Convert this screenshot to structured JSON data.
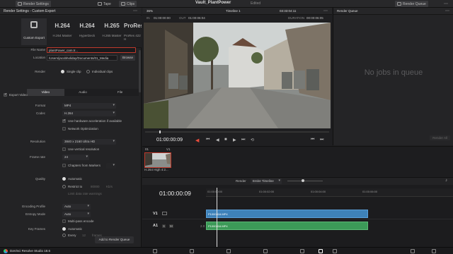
{
  "topbar": {
    "buttons": [
      {
        "label": "Render Settings",
        "icon": "sliders-icon"
      },
      {
        "label": "Tape",
        "icon": "tape-icon"
      },
      {
        "label": "Clips",
        "icon": "clips-icon"
      }
    ],
    "project_title": "Vault_PlantPower",
    "edited_status": "Edited",
    "render_queue_label": "Render Queue"
  },
  "render_settings": {
    "header": "Render Settings - Custom Export",
    "presets": [
      {
        "big": "",
        "label": "Custom Export"
      },
      {
        "big": "H.264",
        "label": "H.264 Master"
      },
      {
        "big": "H.264",
        "label": "HyperDeck"
      },
      {
        "big": "H.265",
        "label": "H.265 Master"
      },
      {
        "big": "ProRes",
        "label": "ProRes 422 H"
      }
    ],
    "file_name_label": "File Name",
    "file_name_value": "plantPower_cam.tr...",
    "location_label": "Location",
    "location_value": "/Users/jacobholiday/Documents/01_Media",
    "browse_label": "Browse",
    "render_label": "Render",
    "single_clip_label": "Single clip",
    "individual_clips_label": "Individual clips",
    "tabs": [
      "Video",
      "Audio",
      "File"
    ],
    "export_video_label": "Export Video",
    "format_label": "Format",
    "format_value": "MP4",
    "codec_label": "Codec",
    "codec_value": "H.264",
    "hw_accel_label": "Use hardware acceleration if available",
    "network_opt_label": "Network Optimization",
    "resolution_label": "Resolution",
    "resolution_value": "3840 x 2160 Ultra HD",
    "vertical_res_label": "Use vertical resolution",
    "frame_rate_label": "Frame rate",
    "frame_rate_value": "24",
    "chapters_label": "Chapters from Markers",
    "quality_label": "Quality",
    "automatic_label": "Automatic",
    "restrict_label": "Restrict to",
    "restrict_value": "80000",
    "kbs_label": "Kb/s",
    "limit_label": "Limit data rate warnings",
    "encoding_profile_label": "Encoding Profile",
    "encoding_profile_value": "Auto",
    "entropy_label": "Entropy Mode",
    "entropy_value": "Auto",
    "multipass_label": "Multi-pass encode",
    "keyframes_label": "Key Frames",
    "keyframes_auto": "Automatic",
    "every_label": "Every",
    "every_value": "12",
    "frames_label": "frames",
    "add_queue_label": "Add to Render Queue"
  },
  "viewer": {
    "zoom": "36%",
    "timeline_name": "Timeline 1",
    "tc_top": "03:33:04:11",
    "in_label": "IN",
    "in_tc": "01:00:00:00",
    "out_label": "OUT",
    "out_tc": "01:00:06:04",
    "duration_label": "DURATION",
    "duration_tc": "00:00:06:05",
    "current_tc": "01:00:00:09"
  },
  "render_queue": {
    "empty_text": "No jobs in queue",
    "render_all_label": "Render All"
  },
  "media_strip": {
    "clip_number": "01",
    "track": "V1",
    "clip_label": "H.264 High 4:2..."
  },
  "timeline": {
    "render_label": "Render",
    "render_value": "Entire Timeline",
    "timecode": "01:00:00:09",
    "ruler_ticks": [
      "01:00:00:00",
      "01:00:02:00",
      "01:00:04:00",
      "01:00:06:00"
    ],
    "v1_label": "V1",
    "a1_label": "A1",
    "a1_s": "S",
    "a1_m": "M",
    "a1_level": "2.0",
    "v1_clip": "P1000416.MP4",
    "a1_clip": "P1000416.MP4"
  },
  "footer": {
    "app_name": "DaVinci Resolve Studio 18.6"
  },
  "colors": {
    "accent_red": "#c0392b",
    "video_clip": "#3e82b9",
    "audio_clip": "#3c9a58"
  }
}
